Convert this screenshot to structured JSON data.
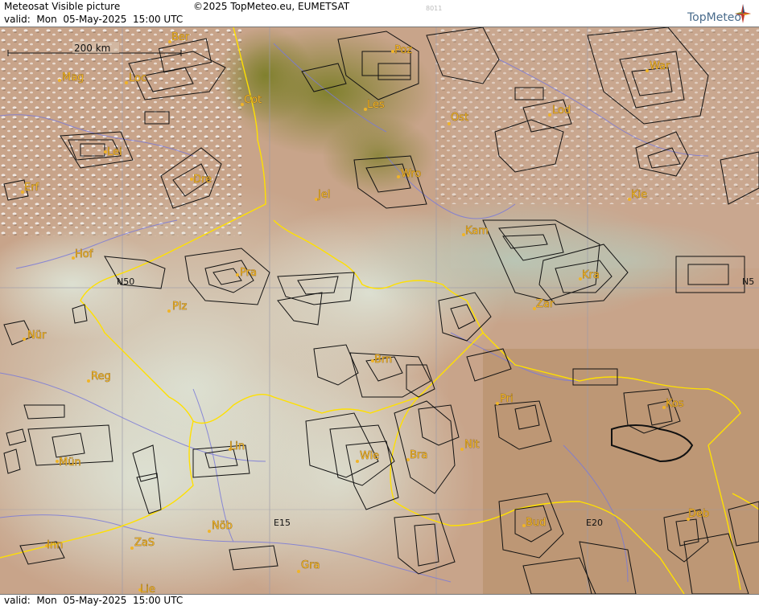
{
  "header": {
    "title": "Meteosat Visible picture",
    "copyright": "©2025 TopMeteo.eu, EUMETSAT",
    "image_code": "8011",
    "valid_label": "valid:  Mon  05-May-2025  15:00 UTC"
  },
  "footer": {
    "valid_label": "valid:  Mon  05-May-2025  15:00 UTC"
  },
  "logo": {
    "text": "TopMeteo"
  },
  "scale": {
    "label": "200 km"
  },
  "coordinates": {
    "n50": "N50",
    "n50_right": "N5",
    "e15": "E15",
    "e20": "E20"
  },
  "cities": [
    {
      "name": "Ber"
    },
    {
      "name": "Poz"
    },
    {
      "name": "War"
    },
    {
      "name": "Mag"
    },
    {
      "name": "Loc"
    },
    {
      "name": "Cot"
    },
    {
      "name": "Les"
    },
    {
      "name": "Ost"
    },
    {
      "name": "Lod"
    },
    {
      "name": "Lei"
    },
    {
      "name": "Dre"
    },
    {
      "name": "Wro"
    },
    {
      "name": "Erf"
    },
    {
      "name": "Jel"
    },
    {
      "name": "Kie"
    },
    {
      "name": "Kam"
    },
    {
      "name": "Hof"
    },
    {
      "name": "Pra"
    },
    {
      "name": "Kra"
    },
    {
      "name": "Plz"
    },
    {
      "name": "Zar"
    },
    {
      "name": "Nür"
    },
    {
      "name": "Brn"
    },
    {
      "name": "Reg"
    },
    {
      "name": "Pri"
    },
    {
      "name": "Kos"
    },
    {
      "name": "Lin"
    },
    {
      "name": "Nit"
    },
    {
      "name": "Mün"
    },
    {
      "name": "Wie"
    },
    {
      "name": "Bra"
    },
    {
      "name": "Inn"
    },
    {
      "name": "ZaS"
    },
    {
      "name": "Nöb"
    },
    {
      "name": "Bud"
    },
    {
      "name": "Deb"
    },
    {
      "name": "Gra"
    },
    {
      "name": "Lie"
    }
  ],
  "colors": {
    "terrain": "#c8a080",
    "forest": "#7a7a2a",
    "cloud": "#d8dccc",
    "border": "#ffe000",
    "river": "#7a7ad8",
    "label": "#f0b428",
    "grid": "#9a9aaa"
  }
}
